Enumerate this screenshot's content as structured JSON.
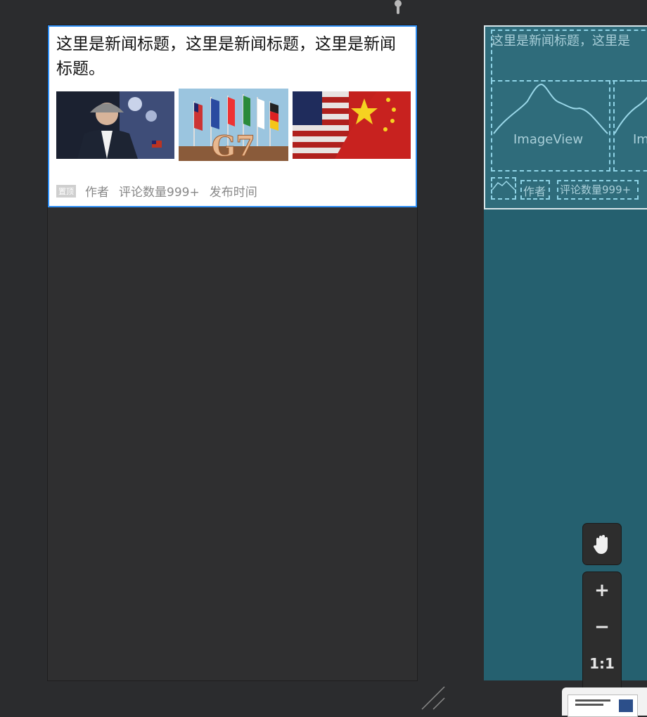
{
  "design": {
    "title": "这里是新闻标题，这里是新闻标题，这里是新闻标题。",
    "meta": {
      "badge": "置顶",
      "author": "作者",
      "comments": "评论数量999+",
      "time": "发布时间"
    },
    "thumbs": [
      "photo-portrait",
      "photo-g7-flags",
      "photo-us-china-flags"
    ],
    "thumb_g7_text": "G7"
  },
  "blueprint": {
    "title_text": "这里是新闻标题，这里是",
    "image_label_1": "ImageView",
    "image_label_2": "Im",
    "author": "作者",
    "comments": "评论数量999+"
  },
  "toolbar": {
    "hand": "hand-tool",
    "zoom_in": "+",
    "zoom_out": "−",
    "reset": "1:1"
  },
  "colors": {
    "selection": "#2f8ff5",
    "blueprint_bg": "#25606f",
    "canvas_bg": "#2b2c2e"
  }
}
